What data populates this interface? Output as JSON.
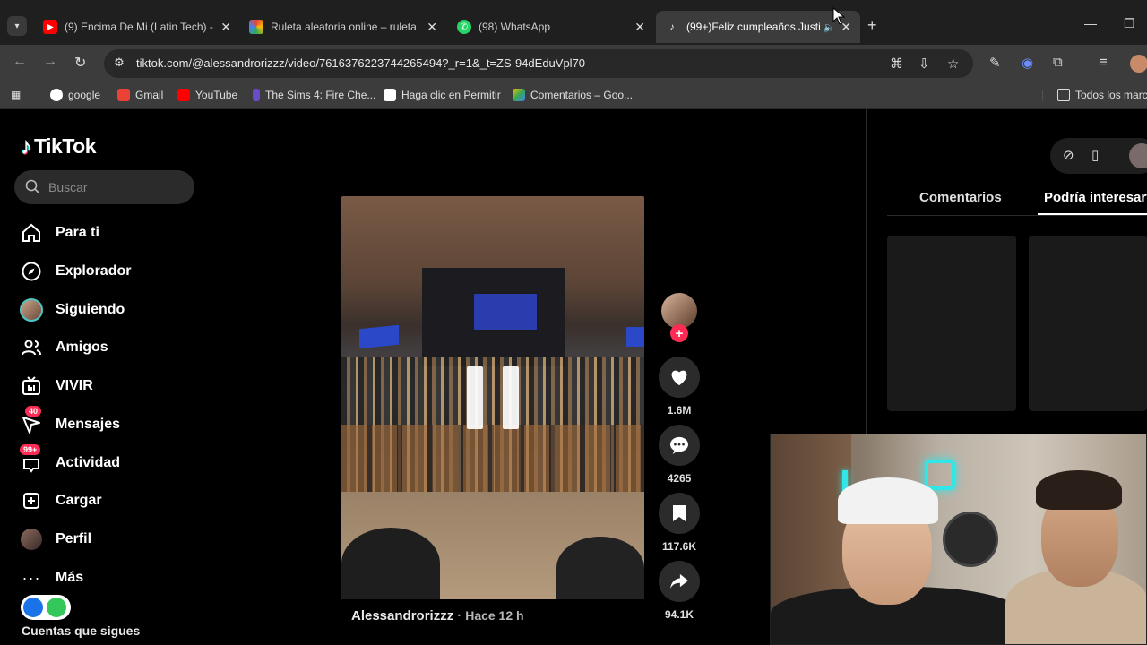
{
  "browser": {
    "tabs": [
      {
        "title": "(9) Encima De Mi (Latin Tech) - ",
        "favicon": "youtube-icon",
        "color": "#ff0000"
      },
      {
        "title": "Ruleta aleatoria online – ruleta",
        "favicon": "wheel-icon",
        "color": "#f4b400"
      },
      {
        "title": "(98) WhatsApp",
        "favicon": "whatsapp-icon",
        "color": "#25d366"
      },
      {
        "title": "(99+)Feliz cumpleaños Justi",
        "favicon": "tiktok-icon",
        "color": "#ffffff",
        "active": true
      }
    ],
    "url": "tiktok.com/@alessandrorizzz/video/7616376223744265494?_r=1&_t=ZS-94dEduVpl70",
    "bookmarks": [
      "google",
      "Gmail",
      "YouTube",
      "The Sims 4: Fire Che...",
      "Haga clic en Permitir",
      "Comentarios – Goo...",
      "Todos los marc"
    ]
  },
  "tiktok": {
    "logo_text": "TikTok",
    "search_placeholder": "Buscar",
    "menu": [
      {
        "label": "Para ti",
        "icon": "home-icon"
      },
      {
        "label": "Explorador",
        "icon": "compass-icon"
      },
      {
        "label": "Siguiendo",
        "icon": "following-avatar-icon"
      },
      {
        "label": "Amigos",
        "icon": "friends-icon"
      },
      {
        "label": "VIVIR",
        "icon": "live-tv-icon"
      },
      {
        "label": "Mensajes",
        "icon": "inbox-icon",
        "badge": "40"
      },
      {
        "label": "Actividad",
        "icon": "activity-icon",
        "badge": "99+"
      },
      {
        "label": "Cargar",
        "icon": "upload-plus-icon"
      },
      {
        "label": "Perfil",
        "icon": "profile-avatar-icon"
      },
      {
        "label": "Más",
        "icon": "more-dots-icon"
      }
    ],
    "following_heading": "Cuentas que sigues",
    "video": {
      "author": "Alessandrorizzz",
      "time": "Hace 12 h"
    },
    "actions": {
      "likes": "1.6M",
      "comments": "4265",
      "saves": "117.6K",
      "shares": "94.1K"
    },
    "right_tabs": [
      "Comentarios",
      "Podría interesarte"
    ],
    "accent": "#fe2c55"
  }
}
